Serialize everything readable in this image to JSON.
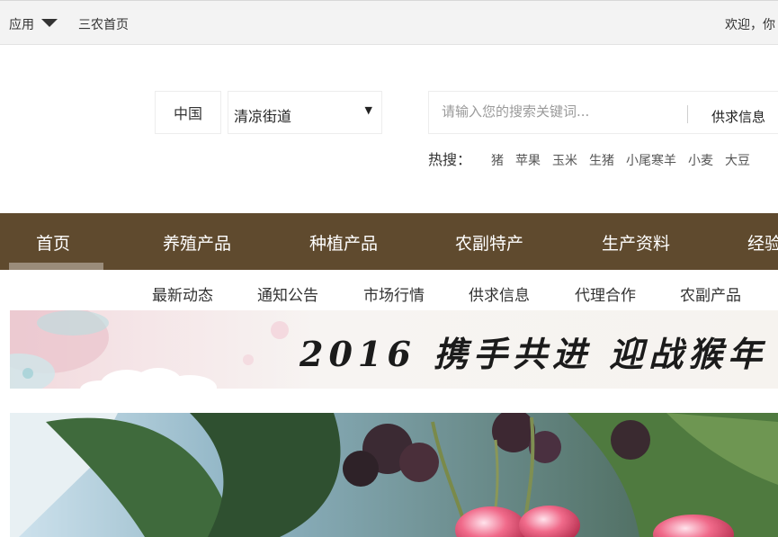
{
  "topbar": {
    "apps_label": "应用",
    "home_label": "三农首页",
    "welcome_text": "欢迎，你"
  },
  "region": {
    "country": "中国",
    "selected": "清凉街道",
    "arrow": "▼"
  },
  "search": {
    "placeholder": "请输入您的搜索关键词...",
    "value": "",
    "category": "供求信息"
  },
  "hot_search": {
    "label": "热搜：",
    "items": [
      "猪",
      "苹果",
      "玉米",
      "生猪",
      "小尾寒羊",
      "小麦",
      "大豆"
    ]
  },
  "main_nav": {
    "items": [
      "首页",
      "养殖产品",
      "种植产品",
      "农副特产",
      "生产资料",
      "经验"
    ],
    "active_index": 0
  },
  "sub_nav": {
    "items": [
      "最新动态",
      "通知公告",
      "市场行情",
      "供求信息",
      "代理合作",
      "农副产品"
    ]
  },
  "banner": {
    "text": "2016 携手共进 迎战猴年"
  },
  "colors": {
    "nav_bg": "#5f4a2e",
    "nav_active_bar": "#9a8c7a",
    "topbar_bg": "#f3f3f3"
  }
}
